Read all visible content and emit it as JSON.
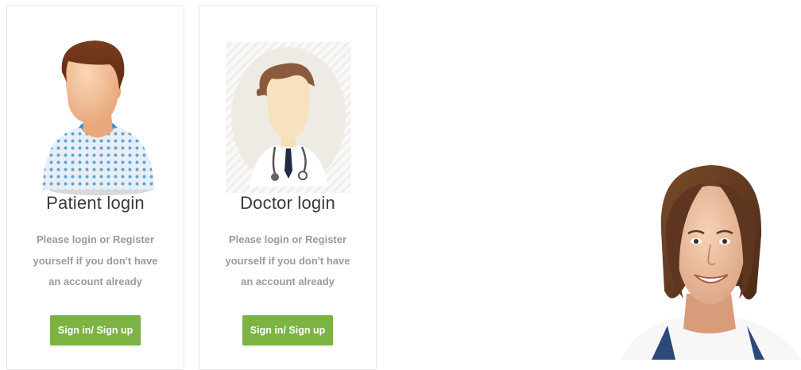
{
  "cards": [
    {
      "title": "Patient login",
      "description": "Please login or Register yourself if you don't have an account already",
      "button_label": "Sign in/ Sign up"
    },
    {
      "title": "Doctor login",
      "description": "Please login or Register yourself if you don't have an account already",
      "button_label": "Sign in/ Sign up"
    }
  ],
  "colors": {
    "button": "#7db343",
    "card_border": "#e6e6e6",
    "title_text": "#3a3a3a",
    "body_text": "#9a9a9a"
  },
  "icons": {
    "patient": "patient-avatar-icon",
    "doctor": "doctor-avatar-icon",
    "hero": "smiling-doctor-photo"
  }
}
